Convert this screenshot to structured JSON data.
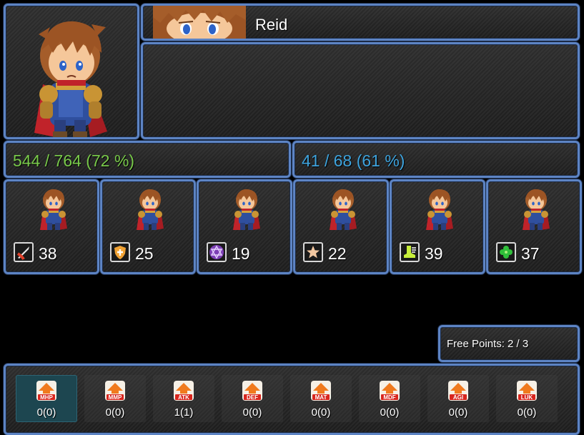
{
  "actor": {
    "name": "Reid",
    "hp_text": "544 / 764 (72 %)",
    "mp_text": "41 / 68 (61 %)"
  },
  "stats": [
    {
      "icon": "sword-icon",
      "value": "38"
    },
    {
      "icon": "shield-icon",
      "value": "25"
    },
    {
      "icon": "hexagram-icon",
      "value": "19"
    },
    {
      "icon": "star-icon",
      "value": "22"
    },
    {
      "icon": "boot-icon",
      "value": "39"
    },
    {
      "icon": "clover-icon",
      "value": "37"
    }
  ],
  "free_points": "Free Points: 2 / 3",
  "params": [
    {
      "label": "MHP",
      "value": "0(0)",
      "selected": true
    },
    {
      "label": "MMP",
      "value": "0(0)"
    },
    {
      "label": "ATK",
      "value": "1(1)"
    },
    {
      "label": "DEF",
      "value": "0(0)"
    },
    {
      "label": "MAT",
      "value": "0(0)"
    },
    {
      "label": "MDF",
      "value": "0(0)"
    },
    {
      "label": "AGI",
      "value": "0(0)"
    },
    {
      "label": "LUK",
      "value": "0(0)"
    }
  ],
  "colors": {
    "window_border": "#5d84c4",
    "hp": "#78c84a",
    "mp": "#3ea3dd",
    "arrow": "#f07a1e"
  }
}
